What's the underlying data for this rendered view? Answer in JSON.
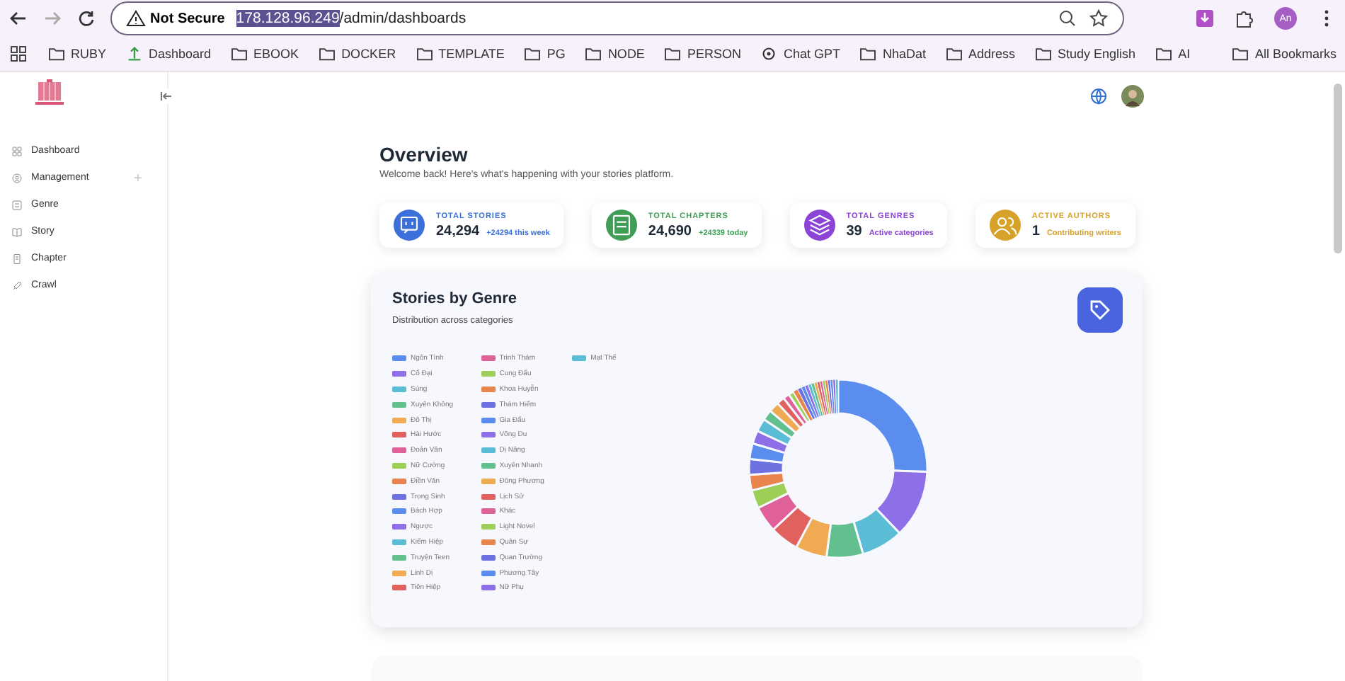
{
  "browser": {
    "security": "Not Secure",
    "url_host": "178.128.96.249",
    "url_path": "/admin/dashboards",
    "profile": "An",
    "bookmarks": [
      {
        "label": "RUBY",
        "kind": "folder"
      },
      {
        "label": "Dashboard",
        "kind": "site"
      },
      {
        "label": "EBOOK",
        "kind": "folder"
      },
      {
        "label": "DOCKER",
        "kind": "folder"
      },
      {
        "label": "TEMPLATE",
        "kind": "folder"
      },
      {
        "label": "PG",
        "kind": "folder"
      },
      {
        "label": "NODE",
        "kind": "folder"
      },
      {
        "label": "PERSON",
        "kind": "folder"
      },
      {
        "label": "Chat GPT",
        "kind": "bot"
      },
      {
        "label": "NhaDat",
        "kind": "folder"
      },
      {
        "label": "Address",
        "kind": "folder"
      },
      {
        "label": "Study English",
        "kind": "folder"
      },
      {
        "label": "AI",
        "kind": "folder"
      }
    ],
    "all_bookmarks": "All Bookmarks"
  },
  "sidebar": {
    "items": [
      {
        "label": "Dashboard",
        "kind": "link"
      },
      {
        "label": "Management",
        "kind": "group"
      },
      {
        "label": "Genre",
        "kind": "link"
      },
      {
        "label": "Story",
        "kind": "link"
      },
      {
        "label": "Chapter",
        "kind": "link"
      },
      {
        "label": "Crawl",
        "kind": "link"
      }
    ]
  },
  "overview": {
    "title": "Overview",
    "subtitle": "Welcome back! Here's what's happening with your stories platform.",
    "stats": [
      {
        "label": "TOTAL STORIES",
        "value": "24,294",
        "note": "+24294 this week",
        "color": "#3b6fd9"
      },
      {
        "label": "TOTAL CHAPTERS",
        "value": "24,690",
        "note": "+24339 today",
        "color": "#3f9d56"
      },
      {
        "label": "TOTAL GENRES",
        "value": "39",
        "note": "Active categories",
        "color": "#8b44d6"
      },
      {
        "label": "ACTIVE AUTHORS",
        "value": "1",
        "note": "Contributing writers",
        "color": "#d6a229"
      }
    ]
  },
  "genre_chart": {
    "title": "Stories by Genre",
    "subtitle": "Distribution across categories",
    "legend": [
      {
        "label": "Ngôn Tình",
        "color": "#5b8def"
      },
      {
        "label": "Cổ Đại",
        "color": "#8e6fe8"
      },
      {
        "label": "Súng",
        "color": "#5bbcd6"
      },
      {
        "label": "Xuyên Không",
        "color": "#62c08f"
      },
      {
        "label": "Đô Thị",
        "color": "#efaa52"
      },
      {
        "label": "Hài Hước",
        "color": "#e0615d"
      },
      {
        "label": "Đoản Văn",
        "color": "#e0609a"
      },
      {
        "label": "Nữ Cường",
        "color": "#9dcf57"
      },
      {
        "label": "Điền Văn",
        "color": "#e9844c"
      },
      {
        "label": "Trọng Sinh",
        "color": "#6d72e0"
      },
      {
        "label": "Bách Hợp",
        "color": "#5b8def"
      },
      {
        "label": "Ngược",
        "color": "#8e6fe8"
      },
      {
        "label": "Kiếm Hiệp",
        "color": "#5bbcd6"
      },
      {
        "label": "Truyện Teen",
        "color": "#62c08f"
      },
      {
        "label": "Linh Dị",
        "color": "#efaa52"
      },
      {
        "label": "Tiên Hiệp",
        "color": "#e0615d"
      },
      {
        "label": "Trinh Thám",
        "color": "#e0609a"
      },
      {
        "label": "Cung Đấu",
        "color": "#9dcf57"
      },
      {
        "label": "Khoa Huyễn",
        "color": "#e9844c"
      },
      {
        "label": "Thám Hiểm",
        "color": "#6d72e0"
      },
      {
        "label": "Gia Đấu",
        "color": "#5b8def"
      },
      {
        "label": "Võng Du",
        "color": "#8e6fe8"
      },
      {
        "label": "Dị Năng",
        "color": "#5bbcd6"
      },
      {
        "label": "Xuyên Nhanh",
        "color": "#62c08f"
      },
      {
        "label": "Đông Phương",
        "color": "#efaa52"
      },
      {
        "label": "Lịch Sử",
        "color": "#e0615d"
      },
      {
        "label": "Khác",
        "color": "#e0609a"
      },
      {
        "label": "Light Novel",
        "color": "#9dcf57"
      },
      {
        "label": "Quân Sự",
        "color": "#e9844c"
      },
      {
        "label": "Quan Trường",
        "color": "#6d72e0"
      },
      {
        "label": "Phương Tây",
        "color": "#5b8def"
      },
      {
        "label": "Nữ Phụ",
        "color": "#8e6fe8"
      },
      {
        "label": "Mạt Thế",
        "color": "#5bbcd6"
      }
    ]
  }
}
